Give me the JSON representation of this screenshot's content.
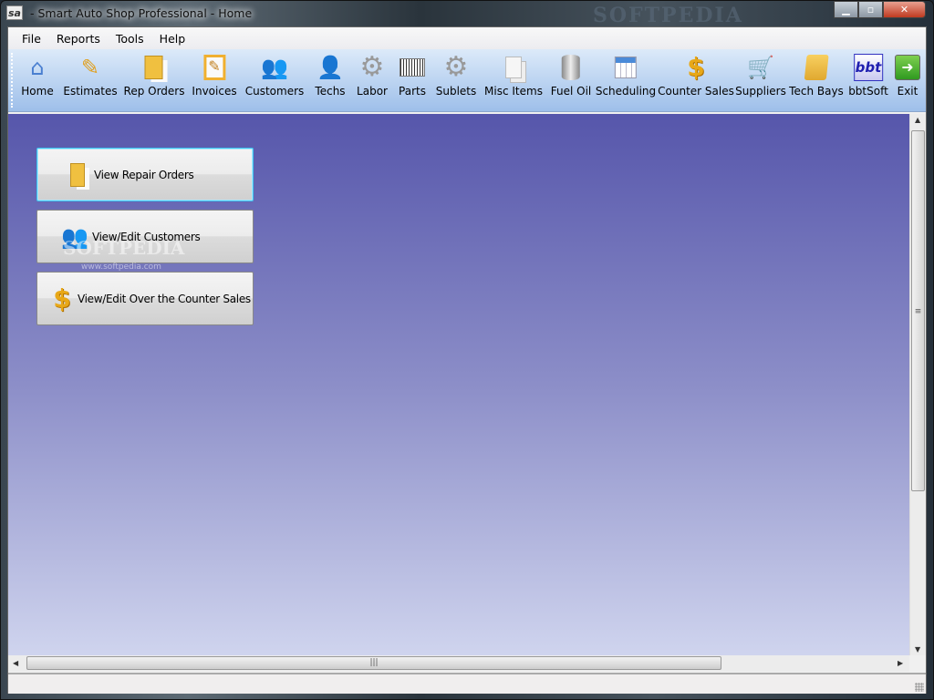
{
  "window": {
    "title": "- Smart Auto Shop Professional  - Home",
    "app_icon": "sa",
    "watermark": "SOFTPEDIA"
  },
  "menu": [
    "File",
    "Reports",
    "Tools",
    "Help"
  ],
  "toolbar": [
    {
      "label": "Home",
      "icon": "house-icon"
    },
    {
      "label": "Estimates",
      "icon": "document-pencil-icon"
    },
    {
      "label": "Rep Orders",
      "icon": "clipboard-folder-icon"
    },
    {
      "label": "Invoices",
      "icon": "clipboard-pencil-icon"
    },
    {
      "label": "Customers",
      "icon": "users-icon"
    },
    {
      "label": "Techs",
      "icon": "user-icon"
    },
    {
      "label": "Labor",
      "icon": "gear-icon"
    },
    {
      "label": "Parts",
      "icon": "barcode-icon"
    },
    {
      "label": "Sublets",
      "icon": "gear-pencil-icon"
    },
    {
      "label": "Misc Items",
      "icon": "documents-icon"
    },
    {
      "label": "Fuel Oil",
      "icon": "barrel-icon"
    },
    {
      "label": "Scheduling",
      "icon": "calendar-icon"
    },
    {
      "label": "Counter Sales",
      "icon": "dollar-icon"
    },
    {
      "label": "Suppliers",
      "icon": "cart-icon"
    },
    {
      "label": "Tech Bays",
      "icon": "scroll-icon"
    },
    {
      "label": "bbtSoft",
      "icon": "bbt-logo-icon",
      "icon_text": "bbt"
    },
    {
      "label": "Exit",
      "icon": "exit-icon"
    }
  ],
  "home_buttons": [
    {
      "label": "View Repair Orders",
      "icon": "clipboard-folder-icon"
    },
    {
      "label": "View/Edit Customers",
      "icon": "users-icon"
    },
    {
      "label": "View/Edit Over the Counter Sales",
      "icon": "dollar-icon"
    }
  ],
  "watermark": {
    "text": "SOFTPEDIA",
    "url": "www.softpedia.com"
  },
  "colors": {
    "content_top": "#5656ab",
    "content_bottom": "#cfd4ee",
    "focus_border": "#3ec3f0"
  }
}
